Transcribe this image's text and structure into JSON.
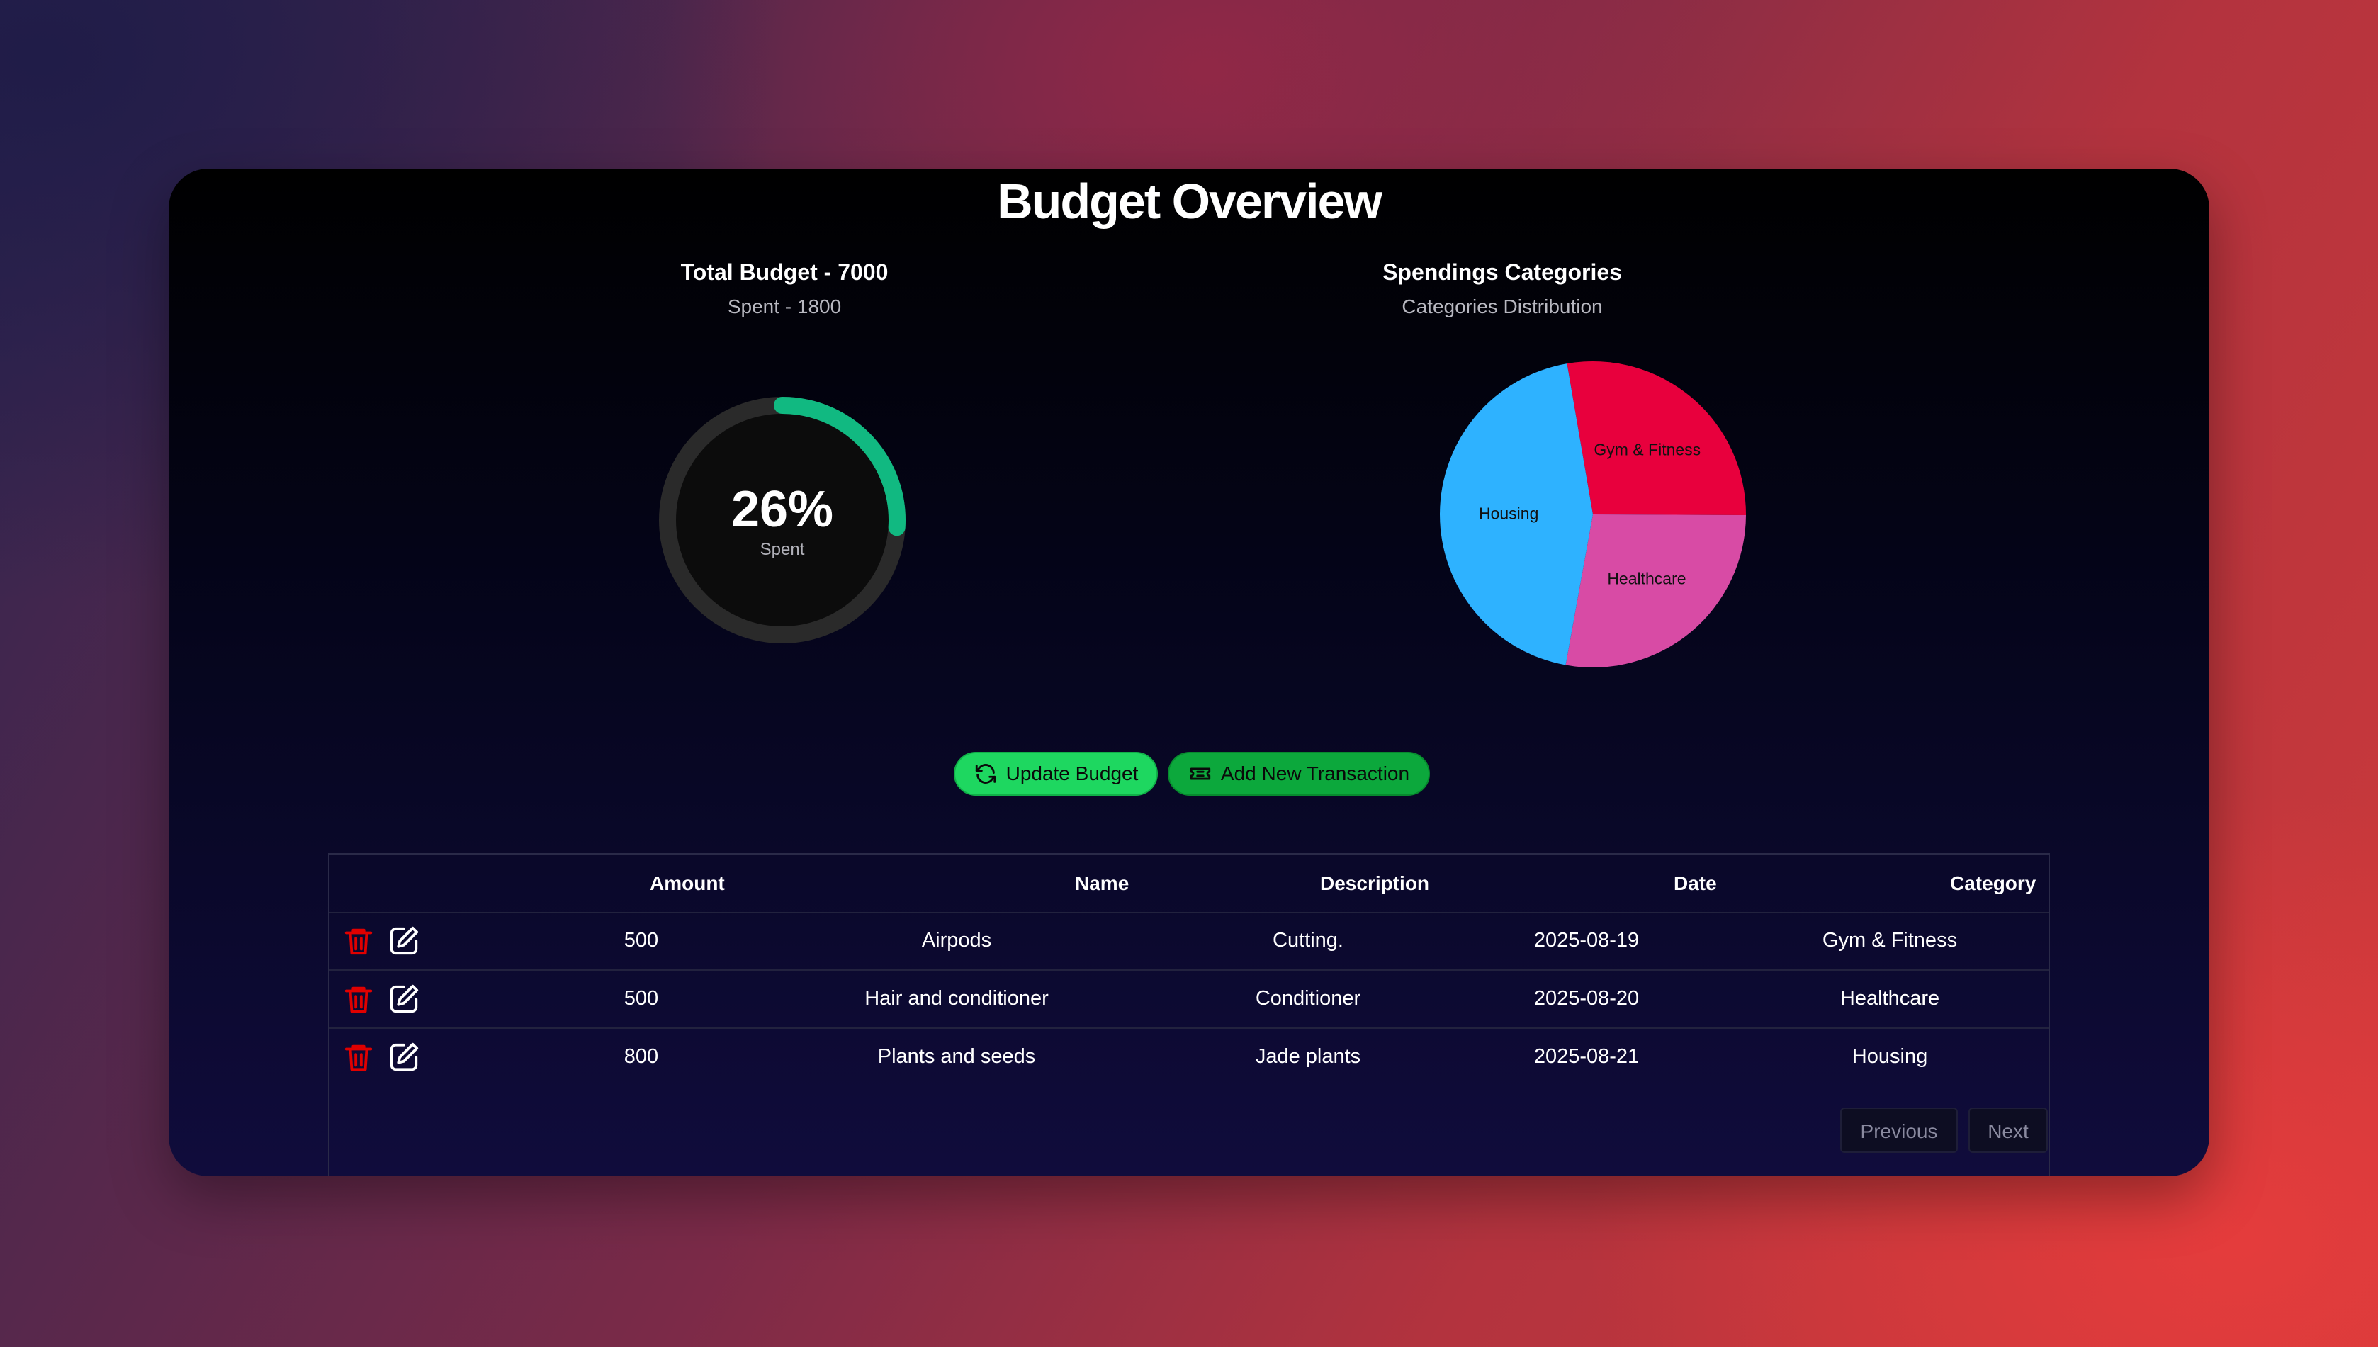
{
  "page": {
    "title": "Budget Overview"
  },
  "budget_card": {
    "heading": "Total Budget - 7000",
    "subheading": "Spent - 1800",
    "percent_text": "26%",
    "percent_label": "Spent",
    "spent_fraction": 0.26,
    "track_color": "#2a2a2a",
    "progress_color": "#11b981"
  },
  "categories_card": {
    "heading": "Spendings Categories",
    "subheading": "Categories Distribution"
  },
  "chart_data": {
    "type": "pie",
    "categories": [
      "Gym & Fitness",
      "Healthcare",
      "Housing"
    ],
    "values": [
      500,
      500,
      800
    ],
    "colors": [
      "#e8003d",
      "#d84ba5",
      "#2eb2ff"
    ]
  },
  "actions": {
    "update_budget": {
      "label": "Update Budget",
      "icon": "refresh-icon"
    },
    "add_transaction": {
      "label": "Add New Transaction",
      "icon": "ticket-icon"
    }
  },
  "table": {
    "columns": [
      "Amount",
      "Name",
      "Description",
      "Date",
      "Category"
    ],
    "rows": [
      {
        "amount": "500",
        "name": "Airpods",
        "description": "Cutting.",
        "date": "2025-08-19",
        "category": "Gym & Fitness"
      },
      {
        "amount": "500",
        "name": "Hair and conditioner",
        "description": "Conditioner",
        "date": "2025-08-20",
        "category": "Healthcare"
      },
      {
        "amount": "800",
        "name": "Plants and seeds",
        "description": "Jade plants",
        "date": "2025-08-21",
        "category": "Housing"
      }
    ],
    "row_icons": [
      "trash-icon",
      "edit-icon"
    ],
    "delete_color": "#e00000"
  },
  "pagination": {
    "previous": "Previous",
    "next": "Next"
  }
}
